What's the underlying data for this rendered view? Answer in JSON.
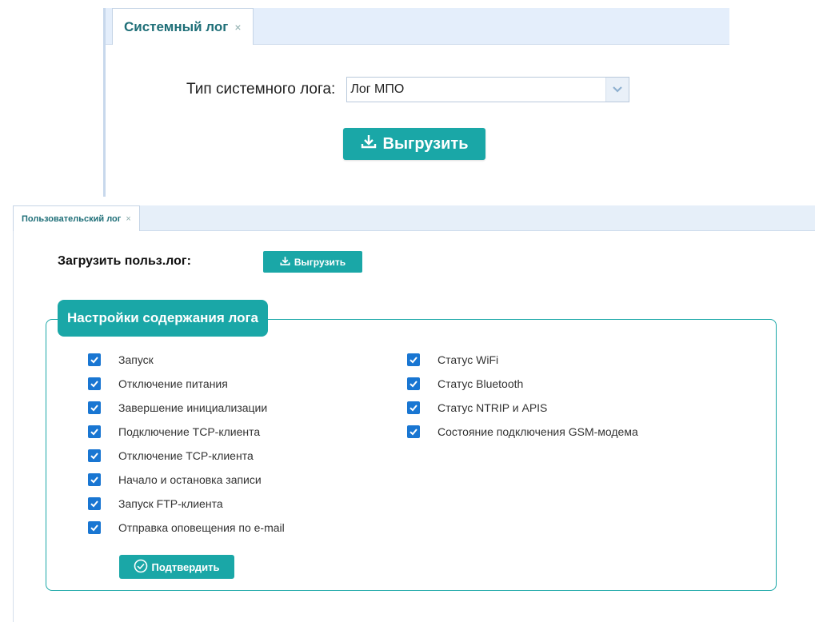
{
  "system_log": {
    "tab_title": "Системный лог",
    "tab_close": "×",
    "type_label": "Тип системного лога:",
    "type_value": "Лог МПО",
    "export_label": "Выгрузить"
  },
  "user_log": {
    "tab_title": "Пользовательский лог",
    "tab_close": "×",
    "load_label": "Загрузить польз.лог:",
    "export_label": "Выгрузить",
    "settings_title": "Настройки содержания лога",
    "left_items": [
      {
        "label": "Запуск",
        "checked": true
      },
      {
        "label": "Отключение питания",
        "checked": true
      },
      {
        "label": "Завершение инициализации",
        "checked": true
      },
      {
        "label": "Подключение TCP-клиента",
        "checked": true
      },
      {
        "label": "Отключение TCP-клиента",
        "checked": true
      },
      {
        "label": "Начало и остановка записи",
        "checked": true
      },
      {
        "label": "Запуск FTP-клиента",
        "checked": true
      },
      {
        "label": "Отправка оповещения по e-mail",
        "checked": true
      }
    ],
    "right_items": [
      {
        "label": "Статус WiFi",
        "checked": true
      },
      {
        "label": "Статус Bluetooth",
        "checked": true
      },
      {
        "label": "Статус NTRIP и APIS",
        "checked": true
      },
      {
        "label": "Состояние подключения GSM-модема",
        "checked": true
      }
    ],
    "confirm_label": "Подтвердить"
  },
  "colors": {
    "accent": "#1aa7a7",
    "checkbox": "#1976d2",
    "tabbar": "#e4eefb"
  }
}
